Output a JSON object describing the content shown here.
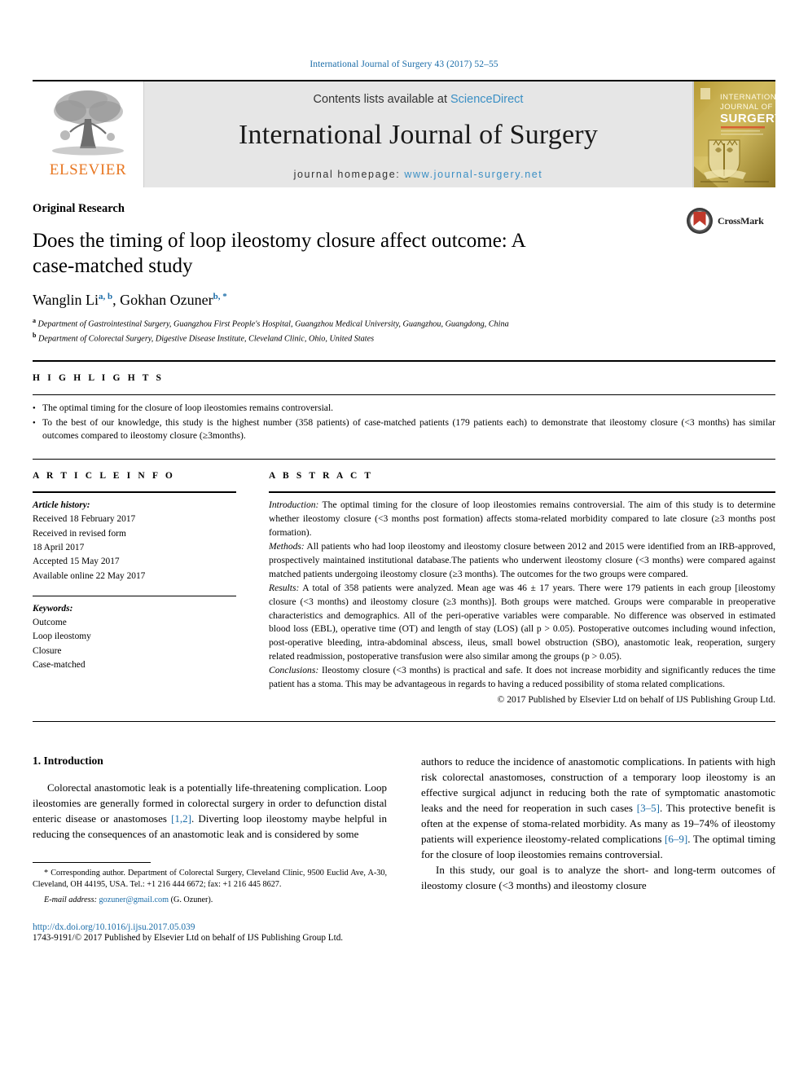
{
  "running_head": "International Journal of Surgery 43 (2017) 52–55",
  "masthead": {
    "publisher_logo_name": "elsevier-tree-logo",
    "publisher_wordmark": "ELSEVIER",
    "contents_prefix": "Contents lists available at ",
    "contents_link": "ScienceDirect",
    "journal_title": "International Journal of Surgery",
    "homepage_prefix": "journal homepage: ",
    "homepage_url": "www.journal-surgery.net",
    "cover_title_line1": "INTERNATIONAL",
    "cover_title_line2": "JOURNAL OF",
    "cover_title_line3": "SURGERY"
  },
  "article": {
    "kicker": "Original Research",
    "title": "Does the timing of loop ileostomy closure affect outcome: A case-matched study",
    "authors_plain": "Wanglin Li",
    "author1": "Wanglin Li",
    "author1_marks": "a, b",
    "author2": "Gokhan Ozuner",
    "author2_marks": "b, *",
    "affiliation_a": "Department of Gastrointestinal Surgery, Guangzhou First People's Hospital, Guangzhou Medical University, Guangzhou, Guangdong, China",
    "affiliation_b": "Department of Colorectal Surgery, Digestive Disease Institute, Cleveland Clinic, Ohio, United States",
    "crossmark_label": "CrossMark"
  },
  "highlights": {
    "heading": "H I G H L I G H T S",
    "items": [
      "The optimal timing for the closure of loop ileostomies remains controversial.",
      "To the best of our knowledge, this study is the highest number (358 patients) of case-matched patients (179 patients each) to demonstrate that ileostomy closure (<3 months) has similar outcomes compared to ileostomy closure (≥3months)."
    ]
  },
  "article_info": {
    "heading": "A R T I C L E   I N F O",
    "history_label": "Article history:",
    "history": [
      "Received 18 February 2017",
      "Received in revised form",
      "18 April 2017",
      "Accepted 15 May 2017",
      "Available online 22 May 2017"
    ],
    "keywords_label": "Keywords:",
    "keywords": [
      "Outcome",
      "Loop ileostomy",
      "Closure",
      "Case-matched"
    ]
  },
  "abstract": {
    "heading": "A B S T R A C T",
    "intro_label": "Introduction:",
    "intro_text": " The optimal timing for the closure of loop ileostomies remains controversial. The aim of this study is to determine whether ileostomy closure (<3 months post formation) affects stoma-related morbidity compared to late closure (≥3 months post formation).",
    "methods_label": "Methods:",
    "methods_text": " All patients who had loop ileostomy and ileostomy closure between 2012 and 2015 were identified from an IRB-approved, prospectively maintained institutional database.The patients who underwent ileostomy closure (<3 months) were compared against matched patients undergoing ileostomy closure (≥3 months). The outcomes for the two groups were compared.",
    "results_label": "Results:",
    "results_text": " A total of 358 patients were analyzed. Mean age was 46 ± 17 years. There were 179 patients in each group [ileostomy closure (<3 months) and ileostomy closure (≥3 months)]. Both groups were matched. Groups were comparable in preoperative characteristics and demographics. All of the peri-operative variables were comparable. No difference was observed in estimated blood loss (EBL), operative time (OT) and length of stay (LOS) (all p > 0.05). Postoperative outcomes including wound infection, post-operative bleeding, intra-abdominal abscess, ileus, small bowel obstruction (SBO), anastomotic leak, reoperation, surgery related readmission, postoperative transfusion were also similar among the groups (p > 0.05).",
    "conclusions_label": "Conclusions:",
    "conclusions_text": " Ileostomy closure (<3 months) is practical and safe. It does not increase morbidity and significantly reduces the time patient has a stoma. This may be advantageous in regards to having a reduced possibility of stoma related complications.",
    "copyright": "© 2017 Published by Elsevier Ltd on behalf of IJS Publishing Group Ltd."
  },
  "body": {
    "section_heading": "1. Introduction",
    "left_para_1a": "Colorectal anastomotic leak is a potentially life-threatening complication. Loop ileostomies are generally formed in colorectal surgery in order to defunction distal enteric disease or anastomoses ",
    "left_ref_1": "[1,2]",
    "left_para_1b": ". Diverting loop ileostomy maybe helpful in reducing the consequences of an anastomotic leak and is considered by some",
    "right_para_1a": "authors to reduce the incidence of anastomotic complications. In patients with high risk colorectal anastomoses, construction of a temporary loop ileostomy is an effective surgical adjunct in reducing both the rate of symptomatic anastomotic leaks and the need for reoperation in such cases ",
    "right_ref_1": "[3–5]",
    "right_para_1b": ". This protective benefit is often at the expense of stoma-related morbidity. As many as 19–74% of ileostomy patients will experience ileostomy-related complications ",
    "right_ref_2": "[6–9]",
    "right_para_1c": ". The optimal timing for the closure of loop ileostomies remains controversial.",
    "right_para_2": "In this study, our goal is to analyze the short- and long-term outcomes of ileostomy closure (<3 months) and ileostomy closure"
  },
  "footnotes": {
    "corresponding": "Corresponding author. Department of Colorectal Surgery, Cleveland Clinic, 9500 Euclid Ave, A-30, Cleveland, OH 44195, USA. Tel.: +1 216 444 6672; fax: +1 216 445 8627.",
    "email_label": "E-mail address:",
    "email": "gozuner@gmail.com",
    "email_suffix": " (G. Ozuner).",
    "doi": "http://dx.doi.org/10.1016/j.ijsu.2017.05.039",
    "issn_prefix": "1743-9191/",
    "issn_rest": "© 2017 Published by Elsevier Ltd on behalf of IJS Publishing Group Ltd."
  },
  "colors": {
    "link": "#1a6ca8",
    "elsevier_orange": "#E87722",
    "masthead_grey": "#e6e6e6",
    "sciencedirect_blue": "#3a8fc4"
  }
}
